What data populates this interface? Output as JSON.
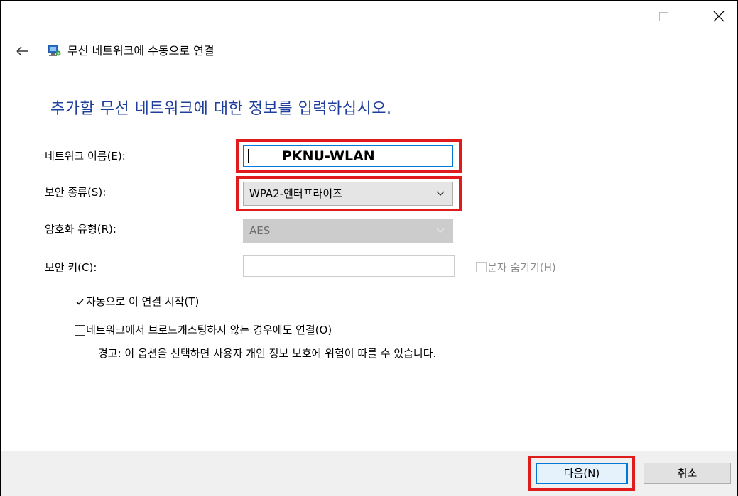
{
  "window": {
    "title": "무선 네트워크에 수동으로 연결",
    "controls": {
      "minimize_icon": "minimize-icon",
      "maximize_icon": "maximize-icon",
      "close_icon": "close-icon"
    }
  },
  "heading": "추가할 무선 네트워크에 대한 정보를 입력하십시오.",
  "form": {
    "network_name": {
      "label": "네트워크 이름(E):",
      "value": "PKNU-WLAN"
    },
    "security_type": {
      "label": "보안 종류(S):",
      "selected": "WPA2-엔터프라이즈"
    },
    "encryption_type": {
      "label": "암호화 유형(R):",
      "selected": "AES",
      "enabled": false
    },
    "security_key": {
      "label": "보안 키(C):",
      "value": "",
      "hide_characters_label": "문자 숨기기(H)",
      "hide_characters_checked": false
    }
  },
  "options": {
    "auto_connect": {
      "label": "자동으로 이 연결 시작(T)",
      "checked": true
    },
    "connect_hidden": {
      "label": "네트워크에서 브로드캐스팅하지 않는 경우에도 연결(O)",
      "checked": false
    },
    "warning": "경고: 이 옵션을 선택하면 사용자 개인 정보 보호에 위험이 따를 수 있습니다."
  },
  "footer": {
    "next_label": "다음(N)",
    "cancel_label": "취소"
  },
  "colors": {
    "heading": "#1f3f9c",
    "highlight": "#e01b1b",
    "focus": "#0078d7"
  }
}
